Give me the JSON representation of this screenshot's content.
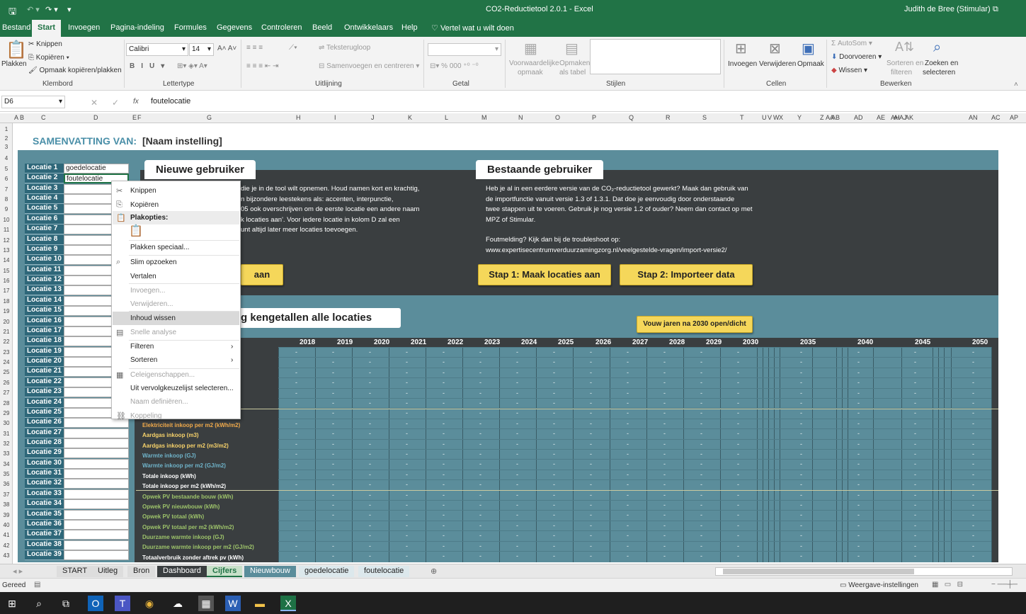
{
  "title": {
    "doc": "CO2-Reductietool 2.0.1",
    "sep": " - ",
    "app": "Excel",
    "user": "Judith de Bree (Stimular)"
  },
  "menu": [
    "Bestand",
    "Start",
    "Invoegen",
    "Pagina-indeling",
    "Formules",
    "Gegevens",
    "Controleren",
    "Beeld",
    "Ontwikkelaars",
    "Help"
  ],
  "tell": "Vertel wat u wilt doen",
  "ribbon": {
    "plakken": "Plakken",
    "knippen": "Knippen",
    "kopieren": "Kopiëren",
    "opmaak_kop": "Opmaak kopiëren/plakken",
    "klembord": "Klembord",
    "font": "Calibri",
    "size": "14",
    "lettertype": "Lettertype",
    "tekstterugloop": "Teksterugloop",
    "samenvoegen": "Samenvoegen en centreren",
    "uitlijning": "Uitlijning",
    "getal": "Getal",
    "voorw1": "Voorwaardelijke",
    "voorw2": "opmaak",
    "opm1": "Opmaken",
    "opm2": "als tabel",
    "stijlen": "Stijlen",
    "invoegen": "Invoegen",
    "verwijderen": "Verwijderen",
    "opmaak": "Opmaak",
    "cellen": "Cellen",
    "autosom": "AutoSom",
    "doorvoeren": "Doorvoeren",
    "wissen": "Wissen",
    "sort1": "Sorteren en",
    "sort2": "filteren",
    "zoek1": "Zoeken en",
    "zoek2": "selecteren",
    "bewerken": "Bewerken"
  },
  "formula": {
    "namebox": "D6",
    "fx": "fx",
    "value": "foutelocatie"
  },
  "columns": [
    "A",
    "B",
    "C",
    "D",
    "E",
    "F",
    "G",
    "H",
    "I",
    "J",
    "K",
    "L",
    "M",
    "N",
    "O",
    "P",
    "Q",
    "R",
    "S",
    "T",
    "U",
    "V",
    "W",
    "X",
    "Y",
    "Z",
    "AA",
    "AB",
    "AD",
    "AE",
    "AH",
    "AI",
    "AJ",
    "AK",
    "AN",
    "AC",
    "AP"
  ],
  "sheet": {
    "samenvatting": "SAMENVATTING VAN:",
    "naam": "[Naam instelling]",
    "nieuw": "Nieuwe gebruiker",
    "bestaand": "Bestaande gebruiker",
    "nieuw_tekst": [
      "die je in de tool wilt opnemen. Houd namen kort en krachtig,",
      "n bijzondere leestekens als: accenten, interpunctie,",
      "05 ook overschrijven om de eerste locatie een andere naam",
      "k locaties aan'. Voor iedere locatie in kolom D zal een",
      "unt altijd later meer locaties toevoegen."
    ],
    "bestaand_tekst": [
      "Heb je al in een eerdere versie van de CO₂-reductietool gewerkt? Maak dan gebruik van",
      "de importfunctie vanuit versie 1.3 of 1.3.1. Dat doe je eenvoudig door onderstaande",
      "twee stappen uit te voeren. Gebruik je nog versie 1.2 of ouder? Neem dan contact op met",
      "MPZ of Stimular."
    ],
    "foutmelding": "Foutmelding? Kijk dan bij de troubleshoot op:",
    "url": "www.expertisecentrumverduurzamingzorg.nl/veelgestelde-vragen/import-versie2/",
    "aan": "aan",
    "stap1": "Stap 1:  Maak locaties aan",
    "stap2": "Stap 2: Importeer data",
    "kengetallen": "g kengetallen alle locaties",
    "vouw": "Vouw jaren na 2030 open/dicht",
    "loc1": "goedelocatie",
    "loc2": "foutelocatie",
    "dash": "-"
  },
  "locations": [
    "Locatie 1",
    "Locatie 2",
    "Locatie 3",
    "Locatie 4",
    "Locatie 5",
    "Locatie 6",
    "Locatie 7",
    "Locatie 8",
    "Locatie 9",
    "Locatie 10",
    "Locatie 11",
    "Locatie 12",
    "Locatie 13",
    "Locatie 14",
    "Locatie 15",
    "Locatie 16",
    "Locatie 17",
    "Locatie 18",
    "Locatie 19",
    "Locatie 20",
    "Locatie 21",
    "Locatie 22",
    "Locatie 23",
    "Locatie 24",
    "Locatie 25",
    "Locatie 26",
    "Locatie 27",
    "Locatie 28",
    "Locatie 29",
    "Locatie 30",
    "Locatie 31",
    "Locatie 32",
    "Locatie 33",
    "Locatie 34",
    "Locatie 35",
    "Locatie 36",
    "Locatie 37",
    "Locatie 38",
    "Locatie 39"
  ],
  "years": [
    "2018",
    "2019",
    "2020",
    "2021",
    "2022",
    "2023",
    "2024",
    "2025",
    "2026",
    "2027",
    "2028",
    "2029",
    "2030",
    "2035",
    "2040",
    "2045",
    "2050"
  ],
  "labels": [
    {
      "t": "Elektriciteit inkoop per m2 (kWh/m2)",
      "c": "#f0a94a"
    },
    {
      "t": "Aardgas inkoop (m3)",
      "c": "#f7d26a"
    },
    {
      "t": "Aardgas inkoop per m2 (m3/m2)",
      "c": "#f7d26a"
    },
    {
      "t": "Warmte inkoop (GJ)",
      "c": "#6fb3c9"
    },
    {
      "t": "Warmte inkoop per m2 (GJ/m2)",
      "c": "#6fb3c9"
    },
    {
      "t": "Totale inkoop (kWh)",
      "c": "#ffffff"
    },
    {
      "t": "Totale inkoop per m2 (kWh/m2)",
      "c": "#ffffff"
    },
    {
      "t": "Opwek PV bestaande bouw (kWh)",
      "c": "#9dc36a"
    },
    {
      "t": "Opwek PV nieuwbouw (kWh)",
      "c": "#9dc36a"
    },
    {
      "t": "Opwek PV totaal (kWh)",
      "c": "#9dc36a"
    },
    {
      "t": "Opwek PV totaal per m2 (kWh/m2)",
      "c": "#9dc36a"
    },
    {
      "t": "Duurzame warmte inkoop (GJ)",
      "c": "#9dc36a"
    },
    {
      "t": "Duurzame warmte inkoop per m2 (GJ/m2)",
      "c": "#9dc36a"
    },
    {
      "t": "Totaalverbruik zonder aftrek pv (kWh)",
      "c": "#ffffff"
    }
  ],
  "context": [
    {
      "t": "Knippen",
      "i": "✂",
      "d": false
    },
    {
      "t": "Kopiëren",
      "i": "⎘",
      "d": false
    },
    {
      "t": "Plakopties:",
      "i": "📋",
      "d": false,
      "h": true
    },
    {
      "t": "Plakken speciaal...",
      "i": "",
      "d": false
    },
    {
      "t": "Slim opzoeken",
      "i": "⌕",
      "d": false
    },
    {
      "t": "Vertalen",
      "i": "",
      "d": false
    },
    {
      "t": "Invoegen...",
      "i": "",
      "d": true
    },
    {
      "t": "Verwijderen...",
      "i": "",
      "d": true
    },
    {
      "t": "Inhoud wissen",
      "i": "",
      "d": false,
      "sel": true
    },
    {
      "t": "Snelle analyse",
      "i": "▤",
      "d": true
    },
    {
      "t": "Filteren",
      "i": "",
      "d": false,
      "sub": true
    },
    {
      "t": "Sorteren",
      "i": "",
      "d": false,
      "sub": true
    },
    {
      "t": "Celeigenschappen...",
      "i": "▦",
      "d": true
    },
    {
      "t": "Uit vervolgkeuzelijst selecteren...",
      "i": "",
      "d": false
    },
    {
      "t": "Naam definiëren...",
      "i": "",
      "d": true
    },
    {
      "t": "Koppeling",
      "i": "⛓",
      "d": true
    }
  ],
  "tabs": [
    "START",
    "Uitleg",
    "Bron",
    "Dashboard",
    "Cijfers",
    "Nieuwbouw",
    "goedelocatie",
    "foutelocatie"
  ],
  "status": {
    "ready": "Gereed",
    "display": "Weergave-instellingen"
  }
}
